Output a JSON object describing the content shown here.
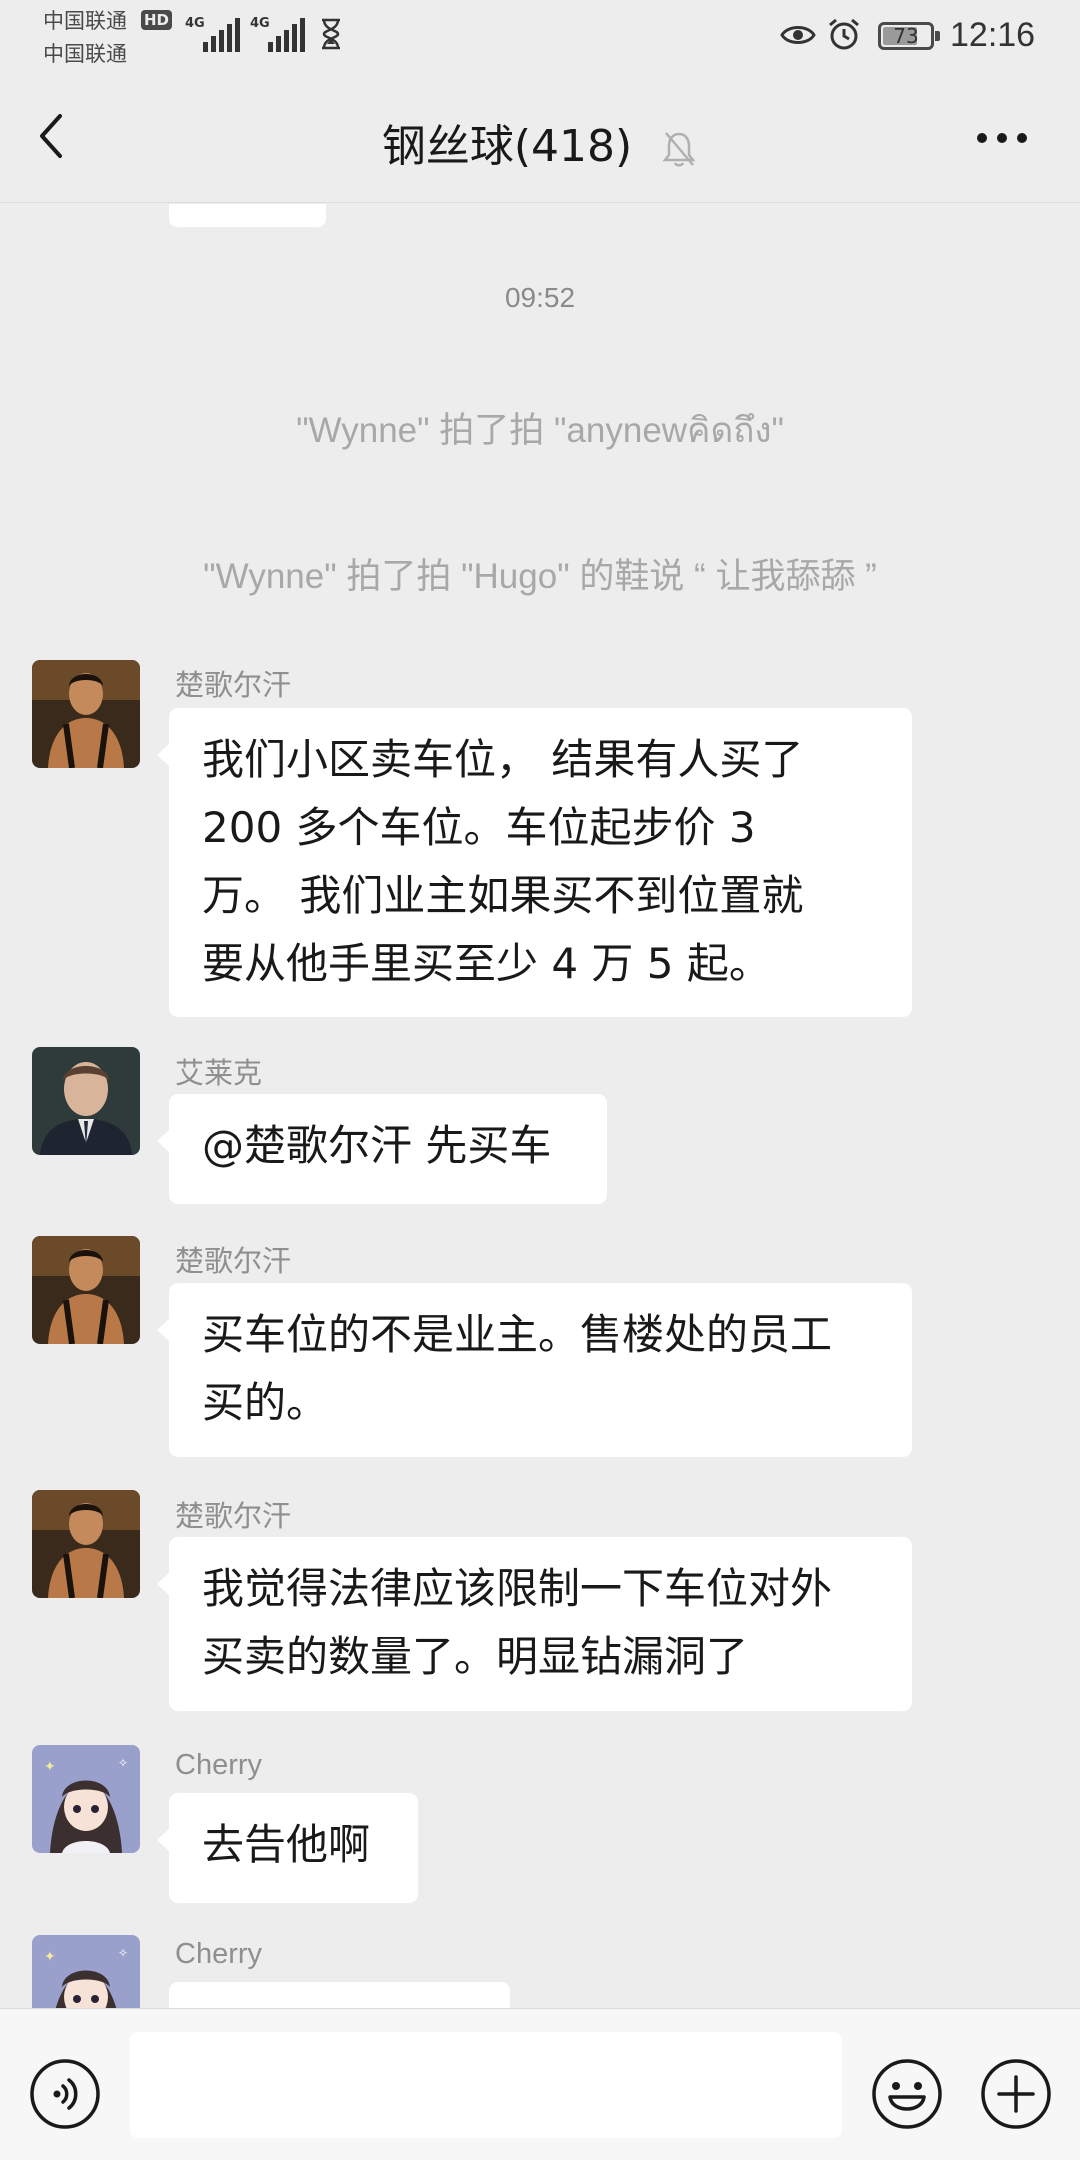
{
  "status_bar": {
    "carrier1": "中国联通",
    "carrier2": "中国联通",
    "hd_badge": "HD",
    "network1": "4G",
    "network2": "4G",
    "battery_percent": "73",
    "battery_level": 0.73,
    "time": "12:16"
  },
  "header": {
    "title": "钢丝球(418)",
    "back_icon": "chevron-left-icon",
    "mute_icon": "bell-muted-icon",
    "more_icon": "more-dots-icon"
  },
  "chat": {
    "timestamp": "09:52",
    "system_messages": [
      "\"Wynne\" 拍了拍 \"anynewคิดถึง\"",
      "\"Wynne\" 拍了拍 \"Hugo\" 的鞋说 “ 让我舔舔 ”"
    ],
    "messages": [
      {
        "sender": "楚歌尔汗",
        "lines": [
          "我们小区卖车位， 结果有人买了",
          "200 多个车位。车位起步价 3",
          "万。  我们业主如果买不到位置就",
          "要从他手里买至少 4 万 5 起。"
        ]
      },
      {
        "sender": "艾莱克",
        "lines": [
          "@楚歌尔汗 先买车"
        ]
      },
      {
        "sender": "楚歌尔汗",
        "lines": [
          "买车位的不是业主。售楼处的员工",
          "买的。"
        ]
      },
      {
        "sender": "楚歌尔汗",
        "lines": [
          "我觉得法律应该限制一下车位对外",
          "买卖的数量了。明显钻漏洞了"
        ]
      },
      {
        "sender": "Cherry",
        "lines": [
          "去告他啊"
        ]
      },
      {
        "sender": "Cherry",
        "lines": []
      }
    ]
  },
  "input_bar": {
    "voice_icon": "voice-icon",
    "message_value": "",
    "emoji_icon": "emoji-icon",
    "plus_icon": "plus-icon"
  },
  "colors": {
    "background": "#ededed",
    "bubble": "#ffffff",
    "nickname": "#8f8f8f",
    "system_text": "#a8a8a8"
  }
}
